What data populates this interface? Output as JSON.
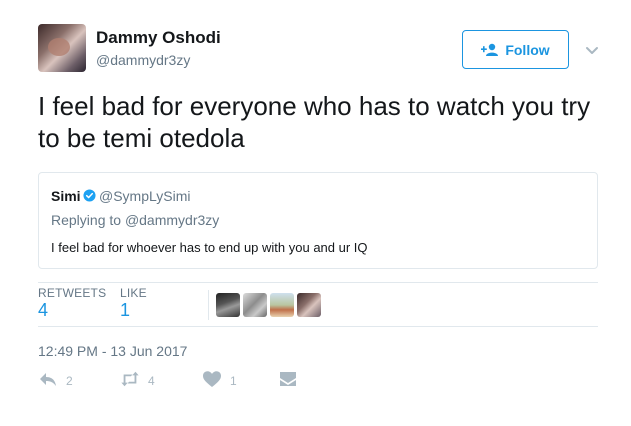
{
  "author": {
    "name": "Dammy Oshodi",
    "handle": "@dammydr3zy"
  },
  "follow_button": {
    "label": "Follow"
  },
  "tweet": {
    "text": "I feel bad for everyone who has to watch you try to be temi otedola"
  },
  "quoted_tweet": {
    "name": "Simi",
    "handle": "@SympLySimi",
    "replying_prefix": "Replying to",
    "replying_to": "@dammydr3zy",
    "text": "I feel bad for whoever has to end up with you and ur IQ"
  },
  "stats": {
    "retweets_label": "RETWEETS",
    "retweets_value": "4",
    "likes_label": "LIKE",
    "likes_value": "1"
  },
  "timestamp": "12:49 PM - 13 Jun 2017",
  "actions": {
    "reply_count": "2",
    "retweet_count": "4",
    "like_count": "1"
  },
  "colors": {
    "accent": "#1b95e0",
    "muted": "#657786",
    "icon": "#aab8c2",
    "verified": "#1da1f2"
  },
  "icons": {
    "follow": "add-user-icon",
    "caret": "chevron-down-icon",
    "verified": "verified-badge-icon",
    "reply": "reply-icon",
    "retweet": "retweet-icon",
    "like": "heart-icon",
    "message": "envelope-icon"
  }
}
